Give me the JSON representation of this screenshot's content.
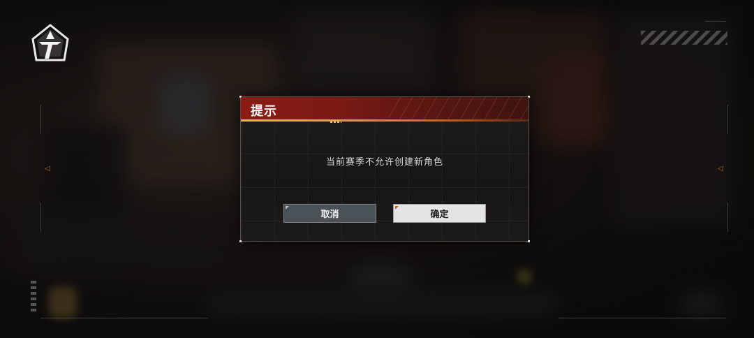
{
  "dialog": {
    "title": "提示",
    "message": "当前赛季不允许创建新角色",
    "cancel_label": "取消",
    "confirm_label": "确定"
  },
  "colors": {
    "header_red": "#8a1c14",
    "accent_yellow": "#e8c030",
    "cancel_bg": "#4a5157",
    "confirm_bg": "#e4e4e4"
  },
  "icons": {
    "logo": "game-emblem-icon",
    "left_marker": "triangle-left-icon",
    "right_marker": "triangle-right-icon"
  }
}
